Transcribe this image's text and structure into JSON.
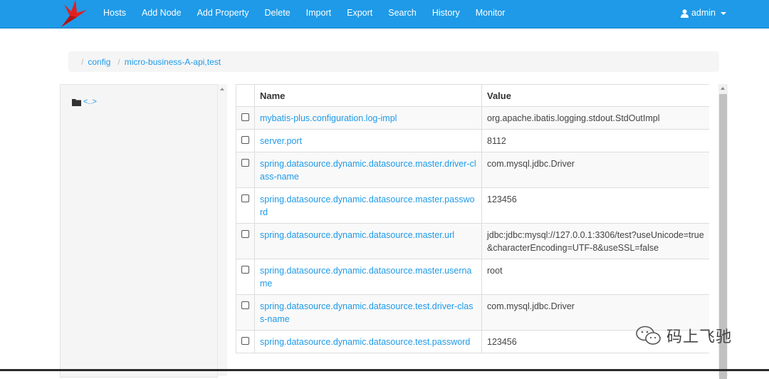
{
  "navbar": {
    "items": [
      "Hosts",
      "Add Node",
      "Add Property",
      "Delete",
      "Import",
      "Export",
      "Search",
      "History",
      "Monitor"
    ],
    "user_label": "admin"
  },
  "breadcrumb": {
    "items": [
      "config",
      "micro-business-A-api,test"
    ]
  },
  "sidebar": {
    "parent_link": "<..>"
  },
  "table": {
    "headers": {
      "name": "Name",
      "value": "Value"
    },
    "rows": [
      {
        "name": "mybatis-plus.configuration.log-impl",
        "value": "org.apache.ibatis.logging.stdout.StdOutImpl"
      },
      {
        "name": "server.port",
        "value": "8112"
      },
      {
        "name": "spring.datasource.dynamic.datasource.master.driver-class-name",
        "value": "com.mysql.jdbc.Driver"
      },
      {
        "name": "spring.datasource.dynamic.datasource.master.password",
        "value": "123456"
      },
      {
        "name": "spring.datasource.dynamic.datasource.master.url",
        "value": "jdbc:jdbc:mysql://127.0.0.1:3306/test?useUnicode=true&characterEncoding=UTF-8&useSSL=false"
      },
      {
        "name": "spring.datasource.dynamic.datasource.master.username",
        "value": "root"
      },
      {
        "name": "spring.datasource.dynamic.datasource.test.driver-class-name",
        "value": "com.mysql.jdbc.Driver"
      },
      {
        "name": "spring.datasource.dynamic.datasource.test.password",
        "value": "123456"
      }
    ]
  },
  "watermark": {
    "text": "码上飞驰"
  },
  "colors": {
    "primary": "#1e9ae8",
    "logo": "#e02020"
  }
}
